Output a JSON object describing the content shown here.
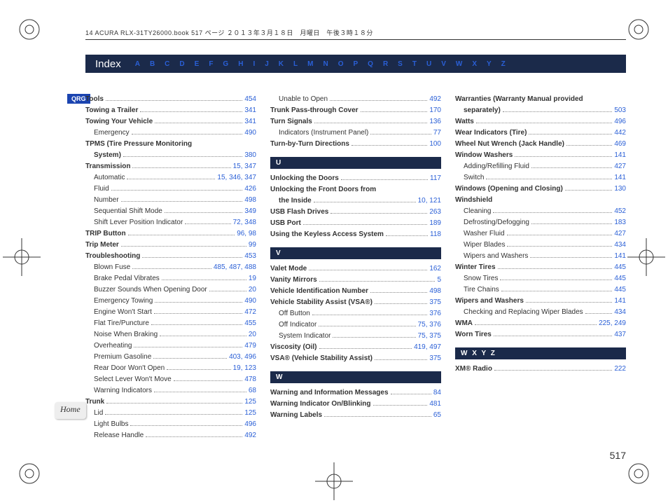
{
  "header_line": "14 ACURA RLX-31TY26000.book  517 ページ  ２０１３年３月１８日　月曜日　午後３時１８分",
  "index_title": "Index",
  "alpha": [
    "A",
    "B",
    "C",
    "D",
    "E",
    "F",
    "G",
    "H",
    "I",
    "J",
    "K",
    "L",
    "M",
    "N",
    "O",
    "P",
    "Q",
    "R",
    "S",
    "T",
    "U",
    "V",
    "W",
    "X",
    "Y",
    "Z"
  ],
  "qrg": "QRG",
  "home": "Home",
  "page_number": "517",
  "sections": {
    "U": "U",
    "V": "V",
    "W": "W",
    "WXYZ": "W   X   Y   Z"
  },
  "col1": [
    {
      "label": "Tools",
      "pages": "454",
      "bold": true
    },
    {
      "label": "Towing a Trailer",
      "pages": "341",
      "bold": true
    },
    {
      "label": "Towing Your Vehicle",
      "pages": "341",
      "bold": true
    },
    {
      "label": "Emergency",
      "pages": "490",
      "sub": true
    },
    {
      "label": "TPMS (Tire Pressure Monitoring",
      "bold": true,
      "nopages": true
    },
    {
      "label": "System)",
      "pages": "380",
      "sub": true,
      "bold": true
    },
    {
      "label": "Transmission",
      "pages": "15, 347",
      "bold": true
    },
    {
      "label": "Automatic",
      "pages": "15, 346, 347",
      "sub": true
    },
    {
      "label": "Fluid",
      "pages": "426",
      "sub": true
    },
    {
      "label": "Number",
      "pages": "498",
      "sub": true
    },
    {
      "label": "Sequential Shift Mode",
      "pages": "349",
      "sub": true
    },
    {
      "label": "Shift Lever Position Indicator",
      "pages": "72, 348",
      "sub": true
    },
    {
      "label": "TRIP Button",
      "pages": "96, 98",
      "bold": true
    },
    {
      "label": "Trip Meter",
      "pages": "99",
      "bold": true
    },
    {
      "label": "Troubleshooting",
      "pages": "453",
      "bold": true
    },
    {
      "label": "Blown Fuse",
      "pages": "485, 487, 488",
      "sub": true
    },
    {
      "label": "Brake Pedal Vibrates",
      "pages": "19",
      "sub": true
    },
    {
      "label": "Buzzer Sounds When Opening Door",
      "pages": "20",
      "sub": true
    },
    {
      "label": "Emergency Towing",
      "pages": "490",
      "sub": true
    },
    {
      "label": "Engine Won't Start",
      "pages": "472",
      "sub": true
    },
    {
      "label": "Flat Tire/Puncture",
      "pages": "455",
      "sub": true
    },
    {
      "label": "Noise When Braking",
      "pages": "20",
      "sub": true
    },
    {
      "label": "Overheating",
      "pages": "479",
      "sub": true
    },
    {
      "label": "Premium Gasoline",
      "pages": "403, 496",
      "sub": true
    },
    {
      "label": "Rear Door Won't Open",
      "pages": "19, 123",
      "sub": true
    },
    {
      "label": "Select Lever Won't Move",
      "pages": "478",
      "sub": true
    },
    {
      "label": "Warning Indicators",
      "pages": "68",
      "sub": true
    },
    {
      "label": "Trunk",
      "pages": "125",
      "bold": true
    },
    {
      "label": "Lid",
      "pages": "125",
      "sub": true
    },
    {
      "label": "Light Bulbs",
      "pages": "496",
      "sub": true
    },
    {
      "label": "Release Handle",
      "pages": "492",
      "sub": true
    }
  ],
  "col2a": [
    {
      "label": "Unable to Open",
      "pages": "492",
      "sub": true
    },
    {
      "label": "Trunk Pass-through Cover",
      "pages": "170",
      "bold": true
    },
    {
      "label": "Turn Signals",
      "pages": "136",
      "bold": true
    },
    {
      "label": "Indicators (Instrument Panel)",
      "pages": "77",
      "sub": true
    },
    {
      "label": "Turn-by-Turn Directions",
      "pages": "100",
      "bold": true
    }
  ],
  "col2u": [
    {
      "label": "Unlocking the Doors",
      "pages": "117",
      "bold": true
    },
    {
      "label": "Unlocking the Front Doors from",
      "bold": true,
      "nopages": true
    },
    {
      "label": "the Inside",
      "pages": "10, 121",
      "sub": true,
      "bold": true
    },
    {
      "label": "USB Flash Drives",
      "pages": "263",
      "bold": true
    },
    {
      "label": "USB Port",
      "pages": "189",
      "bold": true
    },
    {
      "label": "Using the Keyless Access System",
      "pages": "118",
      "bold": true
    }
  ],
  "col2v": [
    {
      "label": "Valet Mode",
      "pages": "162",
      "bold": true
    },
    {
      "label": "Vanity Mirrors",
      "pages": "5",
      "bold": true
    },
    {
      "label": "Vehicle Identification Number",
      "pages": "498",
      "bold": true
    },
    {
      "label": "Vehicle Stability Assist (VSA®)",
      "pages": "375",
      "bold": true
    },
    {
      "label": "Off Button",
      "pages": "376",
      "sub": true
    },
    {
      "label": "Off Indicator",
      "pages": "75, 376",
      "sub": true
    },
    {
      "label": "System Indicator",
      "pages": "75, 375",
      "sub": true
    },
    {
      "label": "Viscosity (Oil)",
      "pages": "419, 497",
      "bold": true
    },
    {
      "label": "VSA® (Vehicle Stability Assist)",
      "pages": "375",
      "bold": true
    }
  ],
  "col2w": [
    {
      "label": "Warning and Information Messages",
      "pages": "84",
      "bold": true
    },
    {
      "label": "Warning Indicator On/Blinking",
      "pages": "481",
      "bold": true
    },
    {
      "label": "Warning Labels",
      "pages": "65",
      "bold": true
    }
  ],
  "col3a": [
    {
      "label": "Warranties (Warranty Manual provided",
      "bold": true,
      "nopages": true
    },
    {
      "label": "separately)",
      "pages": "503",
      "sub": true,
      "bold": true
    },
    {
      "label": "Watts",
      "pages": "496",
      "bold": true
    },
    {
      "label": "Wear Indicators (Tire)",
      "pages": "442",
      "bold": true
    },
    {
      "label": "Wheel Nut Wrench (Jack Handle)",
      "pages": "469",
      "bold": true
    },
    {
      "label": "Window Washers",
      "pages": "141",
      "bold": true
    },
    {
      "label": "Adding/Refilling Fluid",
      "pages": "427",
      "sub": true
    },
    {
      "label": "Switch",
      "pages": "141",
      "sub": true
    },
    {
      "label": "Windows (Opening and Closing)",
      "pages": "130",
      "bold": true
    },
    {
      "label": "Windshield",
      "bold": true,
      "nopages": true
    },
    {
      "label": "Cleaning",
      "pages": "452",
      "sub": true
    },
    {
      "label": "Defrosting/Defogging",
      "pages": "183",
      "sub": true
    },
    {
      "label": "Washer Fluid",
      "pages": "427",
      "sub": true
    },
    {
      "label": "Wiper Blades",
      "pages": "434",
      "sub": true
    },
    {
      "label": "Wipers and Washers",
      "pages": "141",
      "sub": true
    },
    {
      "label": "Winter Tires",
      "pages": "445",
      "bold": true
    },
    {
      "label": "Snow Tires",
      "pages": "445",
      "sub": true
    },
    {
      "label": "Tire Chains",
      "pages": "445",
      "sub": true
    },
    {
      "label": "Wipers and Washers",
      "pages": "141",
      "bold": true
    },
    {
      "label": "Checking and Replacing Wiper Blades",
      "pages": "434",
      "sub": true
    },
    {
      "label": "WMA",
      "pages": "225, 249",
      "bold": true
    },
    {
      "label": "Worn Tires",
      "pages": "437",
      "bold": true
    }
  ],
  "col3b": [
    {
      "label": "XM® Radio",
      "pages": "222",
      "bold": true
    }
  ]
}
